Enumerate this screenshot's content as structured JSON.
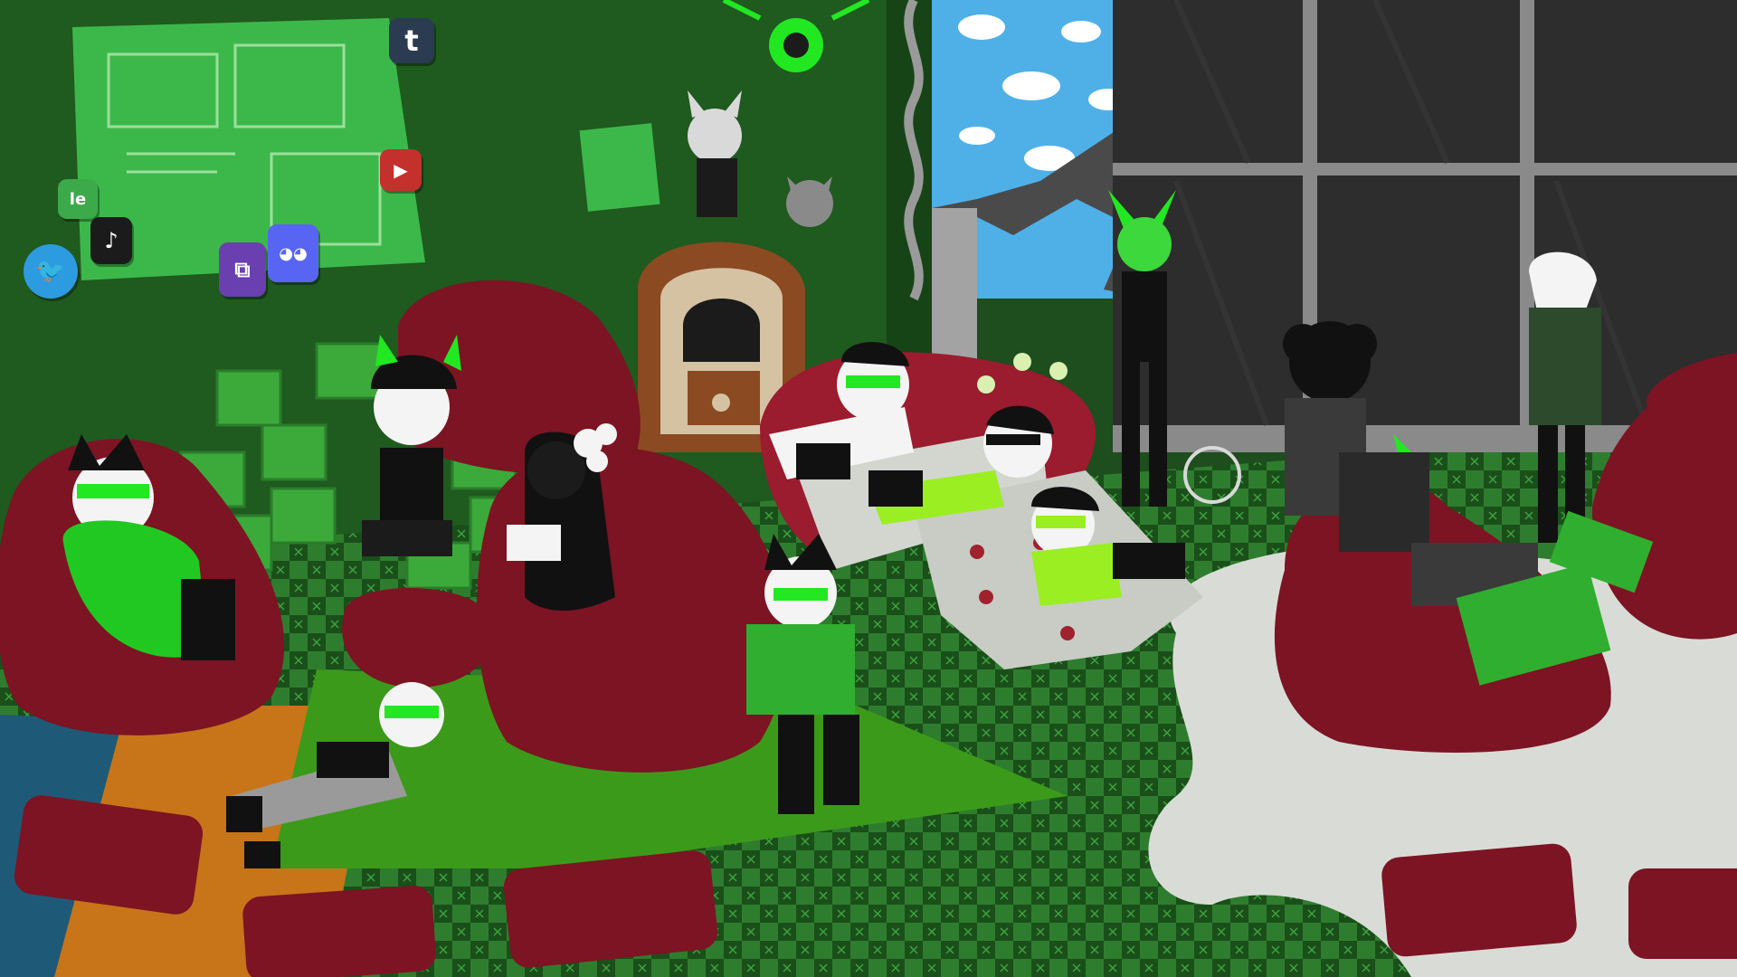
{
  "scene": {
    "description_type": "illustration",
    "palette": {
      "wall": "#1f5a1f",
      "wall_dark": "#174417",
      "floor_light": "#2e7d2e",
      "floor_dark": "#1a4f1a",
      "beanbag": "#7c1423",
      "beanbag_light": "#9a1c2e",
      "accent_green": "#22e822",
      "rug_green": "#3c9a1a",
      "rug_orange": "#c87418",
      "rug_blue": "#1e5a78",
      "white_rug": "#d9dcd6",
      "sky": "#4fb0e8",
      "window_glass": "#2d2d2d",
      "window_frame": "#8a8a8a",
      "jukebox_wood": "#8b4a22"
    },
    "app_icons": [
      {
        "name": "tumblr-icon",
        "glyph": "t",
        "color": "#2b3b52"
      },
      {
        "name": "youtube-icon",
        "glyph": "▶",
        "color": "#c4302b"
      },
      {
        "name": "deviantart-icon",
        "glyph": "le",
        "color": "#3caa4a"
      },
      {
        "name": "tiktok-icon",
        "glyph": "♪",
        "color": "#1b1b1b"
      },
      {
        "name": "twitter-icon",
        "glyph": "🐦",
        "color": "#2d9be0"
      },
      {
        "name": "twitch-icon",
        "glyph": "⧉",
        "color": "#6a3fb0"
      },
      {
        "name": "discord-icon",
        "glyph": "◕◕",
        "color": "#5865f2"
      }
    ],
    "characters": [
      "character-on-left-beanbag",
      "character-sitting-by-blocks",
      "character-with-white-flower",
      "character-on-jukebox",
      "character-on-couch",
      "character-sunglasses-lying",
      "character-reading-center",
      "character-lying-on-floor",
      "character-standing-by-window",
      "character-horned-standing",
      "character-curly-hair-sitting",
      "character-on-right-beanbag",
      "flying-creature"
    ]
  }
}
